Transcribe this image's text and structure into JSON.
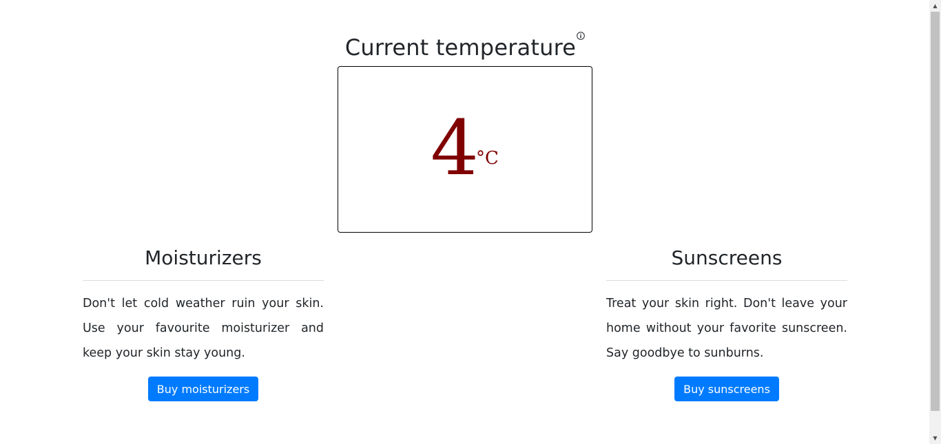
{
  "header": {
    "title": "Current temperature",
    "info_icon": "info-circle-icon"
  },
  "temperature": {
    "value": "4",
    "unit": "°C",
    "color": "#800000"
  },
  "moisturizers": {
    "heading": "Moisturizers",
    "description": "Don't let cold weather ruin your skin. Use your favourite moisturizer and keep your skin stay young.",
    "button_label": "Buy moisturizers"
  },
  "sunscreens": {
    "heading": "Sunscreens",
    "description": "Treat your skin right. Don't leave your home without your favorite sunscreen. Say goodbye to sunburns.",
    "button_label": "Buy sunscreens"
  },
  "theme": {
    "button_color": "#007bff"
  }
}
